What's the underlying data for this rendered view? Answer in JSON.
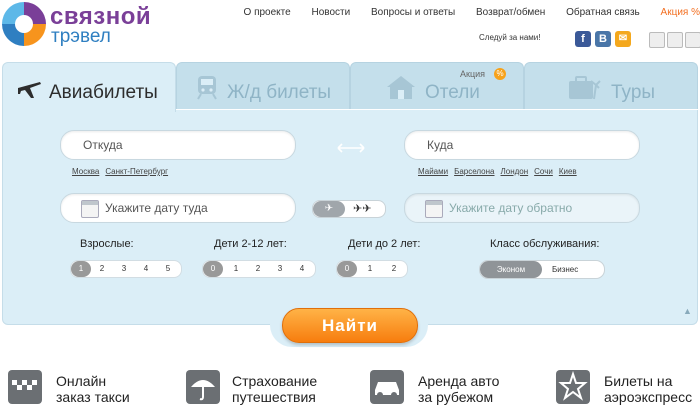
{
  "logo": {
    "name": "связной",
    "sub": "трэвел"
  },
  "topnav": [
    "О проекте",
    "Новости",
    "Вопросы и ответы",
    "Возврат/обмен",
    "Обратная связь"
  ],
  "topnav_accent": "Акция %",
  "follow_label": "Следуй за нами!",
  "social": [
    {
      "letter": "f",
      "color": "#3b5998"
    },
    {
      "letter": "В",
      "color": "#4a76a8"
    },
    {
      "letter": "✉",
      "color": "#f4a81d"
    }
  ],
  "tabs": [
    {
      "label": "Авиабилеты",
      "icon": "airplane-icon",
      "active": true
    },
    {
      "label": "Ж/д билеты",
      "icon": "train-icon",
      "active": false
    },
    {
      "label": "Отели",
      "icon": "house-icon",
      "active": false,
      "badge": "Акция"
    },
    {
      "label": "Туры",
      "icon": "suitcase-icon",
      "active": false
    }
  ],
  "from": {
    "placeholder": "Откуда",
    "quick": [
      "Москва",
      "Санкт-Петербург"
    ]
  },
  "to": {
    "placeholder": "Куда",
    "quick": [
      "Майами",
      "Барселона",
      "Лондон",
      "Сочи",
      "Киев"
    ]
  },
  "date_there": "Укажите дату туда",
  "date_back": "Укажите дату обратно",
  "adults": {
    "label": "Взрослые:",
    "options": [
      "1",
      "2",
      "3",
      "4",
      "5"
    ],
    "selected": 0
  },
  "children": {
    "label": "Дети 2-12 лет:",
    "options": [
      "0",
      "1",
      "2",
      "3",
      "4"
    ],
    "selected": 0
  },
  "infants": {
    "label": "Дети до 2 лет:",
    "options": [
      "0",
      "1",
      "2"
    ],
    "selected": 0
  },
  "service_class": {
    "label": "Класс обслуживания:",
    "options": [
      "Эконом",
      "Бизнес"
    ],
    "selected": 0
  },
  "search_button": "Найти",
  "services": [
    {
      "line1": "Онлайн",
      "line2": "заказ такси",
      "icon": "taxi-icon"
    },
    {
      "line1": "Страхование",
      "line2": "путешествия",
      "icon": "umbrella-icon"
    },
    {
      "line1": "Аренда авто",
      "line2": "за рубежом",
      "icon": "car-icon"
    },
    {
      "line1": "Билеты на",
      "line2": "аэроэкспресс",
      "icon": "train-ticket-icon"
    }
  ],
  "colors": {
    "accent": "#f36f21",
    "brand_purple": "#7a3f98",
    "brand_blue": "#2f7fc1",
    "panel": "#dbeef7"
  }
}
